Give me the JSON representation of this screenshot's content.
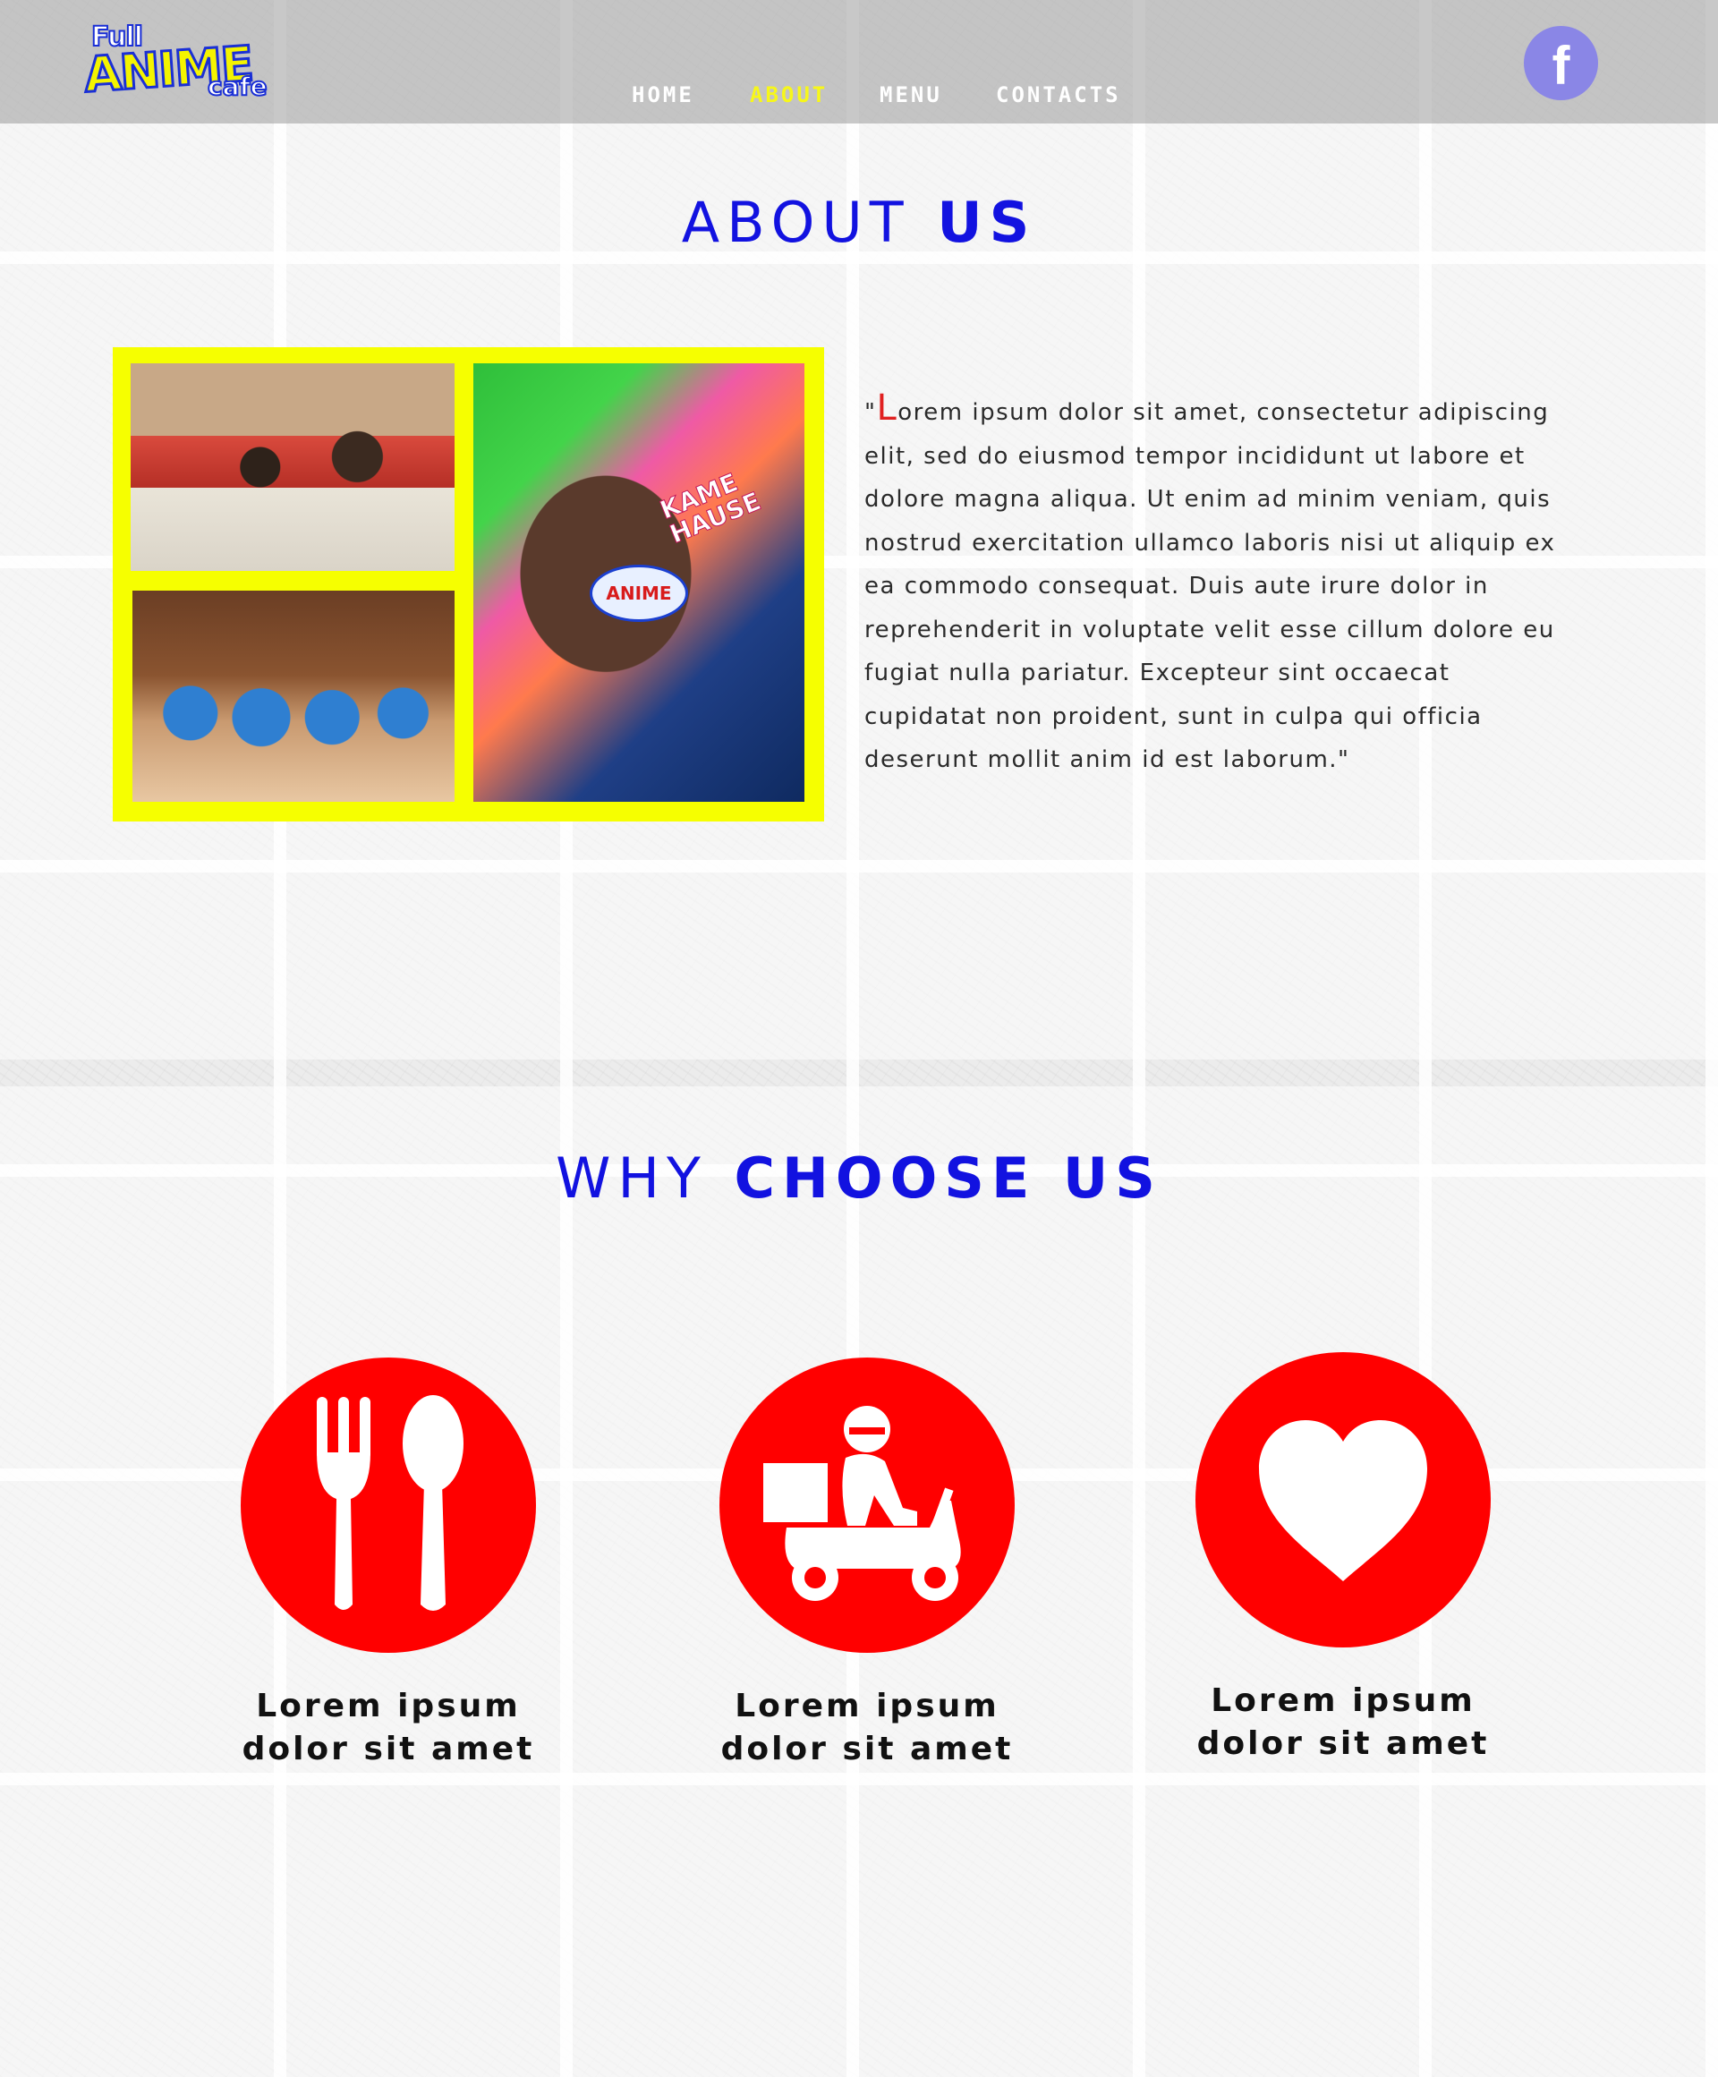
{
  "header": {
    "logo": {
      "line1": "Full",
      "line2": "ANIME",
      "line3": "cafe"
    },
    "nav": [
      {
        "label": "HOME",
        "active": false
      },
      {
        "label": "ABOUT",
        "active": true
      },
      {
        "label": "MENU",
        "active": false
      },
      {
        "label": "CONTACTS",
        "active": false
      }
    ],
    "social": {
      "label": "f",
      "icon": "facebook-icon",
      "color": "#8a86e6"
    }
  },
  "about": {
    "title_light": "ABOUT",
    "title_bold": "US",
    "photos": {
      "photo_3_sign": "KAME HAUSE",
      "photo_3_cup_label": "ANIME"
    },
    "quote_open": "\"",
    "drop_cap": "L",
    "text": "orem ipsum dolor sit amet, consectetur adipiscing elit, sed do eiusmod tempor incididunt ut labore et dolore magna aliqua. Ut enim ad minim veniam, quis nostrud exercitation ullamco laboris nisi ut aliquip ex ea commodo consequat. Duis aute irure dolor in reprehenderit in voluptate velit esse cillum dolore eu fugiat nulla pariatur. Excepteur sint occaecat cupidatat non proident, sunt in culpa qui officia deserunt mollit anim id est laborum.\""
  },
  "why": {
    "title_light": "WHY",
    "title_bold": "CHOOSE US",
    "features": [
      {
        "icon": "fork-spoon-icon",
        "line1": "Lorem ipsum",
        "line2": "dolor sit amet"
      },
      {
        "icon": "delivery-scooter-icon",
        "line1": "Lorem ipsum",
        "line2": "dolor sit amet"
      },
      {
        "icon": "heart-icon",
        "line1": "Lorem ipsum",
        "line2": "dolor sit amet"
      }
    ]
  },
  "colors": {
    "title_blue": "#1212e0",
    "accent_red": "#ff0000",
    "collage_yellow": "#f6ff00",
    "nav_active": "#f7f71a"
  }
}
